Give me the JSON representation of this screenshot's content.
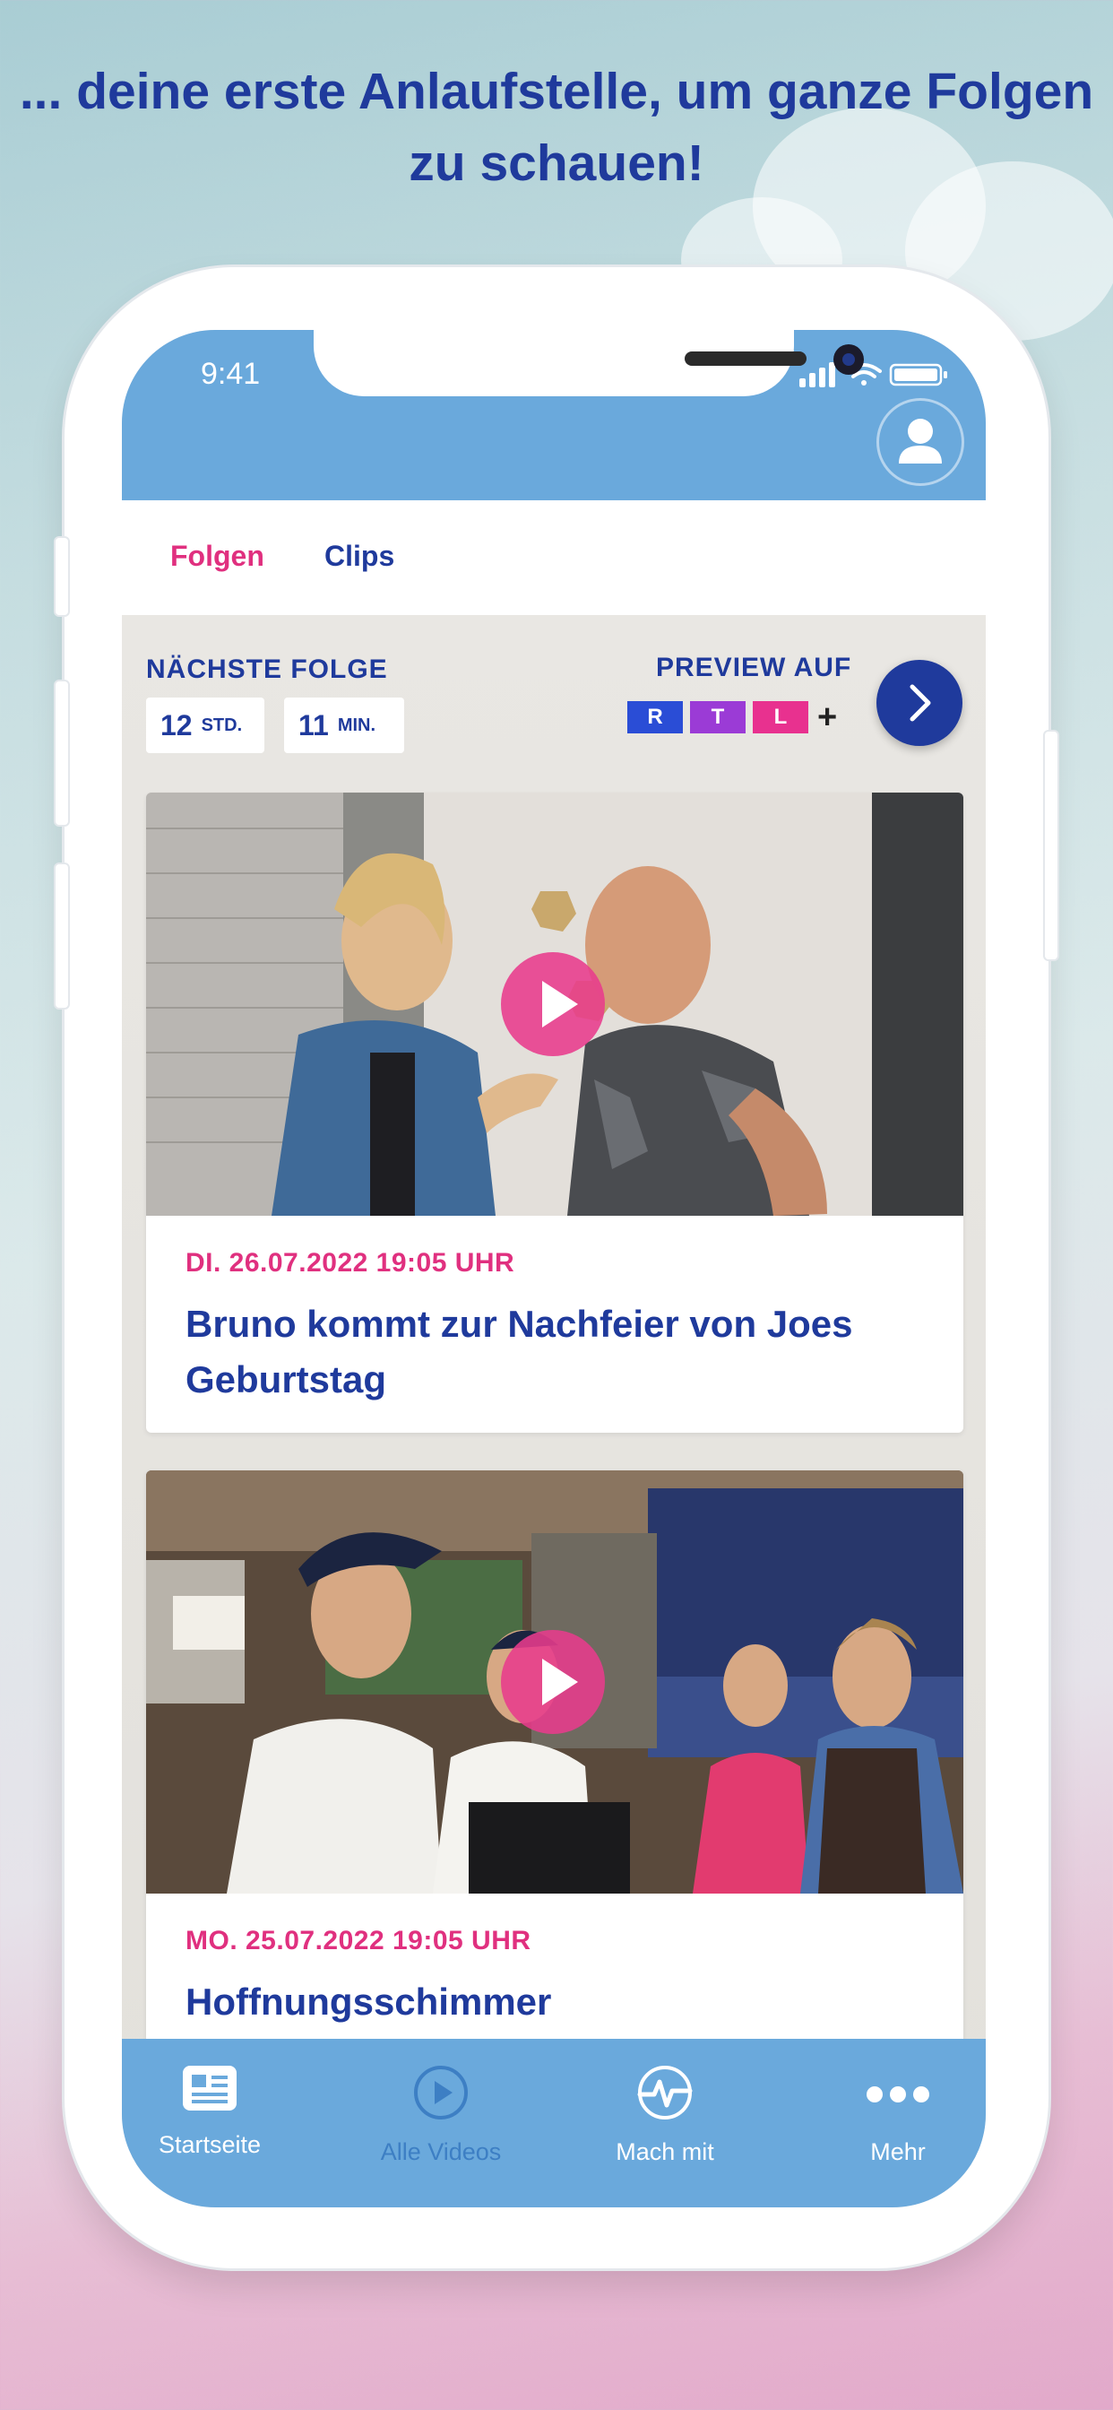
{
  "headline": "... deine erste Anlaufstelle, um ganze Folgen zu schauen!",
  "status_bar": {
    "time": "9:41"
  },
  "tabs": [
    {
      "label": "Folgen",
      "active": true
    },
    {
      "label": "Clips",
      "active": false
    }
  ],
  "next_episode": {
    "label": "NÄCHSTE FOLGE",
    "hours": "12",
    "hours_unit": "STD.",
    "minutes": "11",
    "minutes_unit": "MIN."
  },
  "preview": {
    "label": "PREVIEW AUF",
    "logo_letters": [
      "R",
      "T",
      "L"
    ],
    "logo_plus": "+",
    "logo_colors": [
      "#2a4dd6",
      "#9b3bd6",
      "#e8318f"
    ]
  },
  "episodes": [
    {
      "date": "DI. 26.07.2022 19:05 UHR",
      "title": "Bruno kommt zur Nachfeier von Joes Geburtstag"
    },
    {
      "date": "MO. 25.07.2022 19:05 UHR",
      "title": "Hoffnungsschimmer"
    }
  ],
  "bottom_nav": [
    {
      "label": "Startseite",
      "icon": "news-icon",
      "active": true
    },
    {
      "label": "Alle Videos",
      "icon": "play-circle-icon",
      "active": false
    },
    {
      "label": "Mach mit",
      "icon": "pulse-icon",
      "active": true
    },
    {
      "label": "Mehr",
      "icon": "more-dots-icon",
      "active": true
    }
  ],
  "colors": {
    "accent_blue": "#1f3a9c",
    "bar_blue": "#6aa9dc",
    "accent_pink": "#e0307f"
  }
}
